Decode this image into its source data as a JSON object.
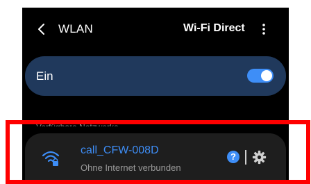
{
  "header": {
    "title": "WLAN",
    "wifi_direct_label": "Wi-Fi Direct",
    "icons": [
      "back-icon",
      "more-vertical-icon"
    ]
  },
  "master_switch": {
    "label": "Ein",
    "state": "on",
    "accent_color": "#3e8ef7"
  },
  "section": {
    "header": "Verfügbare Netzwerke"
  },
  "network": {
    "name": "call_CFW-008D",
    "status": "Ohne Internet verbunden",
    "icons": [
      "wifi-lock-icon",
      "help-icon",
      "settings-icon"
    ],
    "help_glyph": "?"
  },
  "colors": {
    "background": "#000000",
    "master_row": "#20395c",
    "card": "#1e1e1e",
    "highlight": "#ff0000"
  }
}
